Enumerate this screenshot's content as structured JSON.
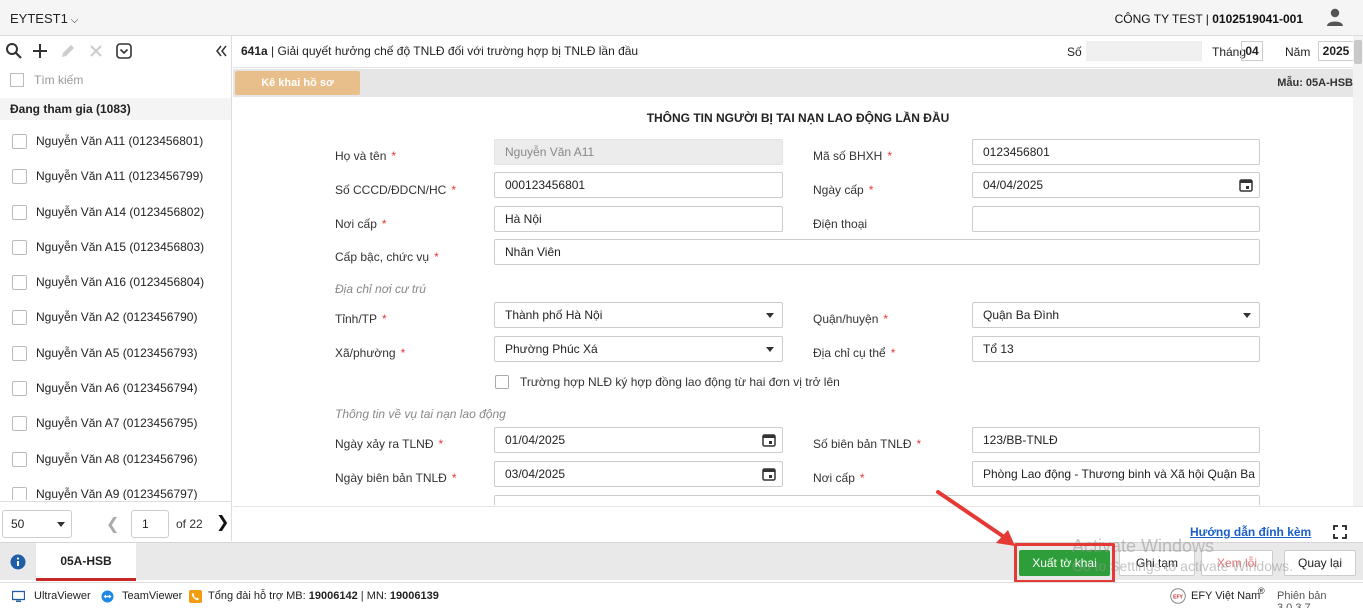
{
  "topbar": {
    "tenant": "EYTEST1",
    "company_name": "CÔNG TY TEST | ",
    "company_code": "0102519041-001"
  },
  "left_panel": {
    "search_placeholder": "Tìm kiếm",
    "group_label": "Đang tham gia (1083)",
    "items": [
      "Nguyễn Văn A11 (0123456801)",
      "Nguyễn Văn A11 (0123456799)",
      "Nguyễn Văn A14 (0123456802)",
      "Nguyễn Văn A15 (0123456803)",
      "Nguyễn Văn A16 (0123456804)",
      "Nguyễn Văn A2 (0123456790)",
      "Nguyễn Văn A5 (0123456793)",
      "Nguyễn Văn A6 (0123456794)",
      "Nguyễn Văn A7 (0123456795)",
      "Nguyễn Văn A8 (0123456796)",
      "Nguyễn Văn A9 (0123456797)"
    ],
    "pager": {
      "page_size": "50",
      "page": "1",
      "of_label": "of 22"
    }
  },
  "header": {
    "code": "641a",
    "title": " | Giải quyết hưởng chế độ TNLĐ đối với trường hợp bị TNLĐ lần đầu",
    "so_label": "Số",
    "thang_label": "Tháng",
    "thang_value": "04",
    "nam_label": "Năm",
    "nam_value": "2025"
  },
  "subbar": {
    "kekhai_label": "Kê khai hồ sơ",
    "mau_label": "Mẫu: 05A-HSB"
  },
  "form": {
    "title": "THÔNG TIN NGƯỜI BỊ TAI NẠN LAO ĐỘNG LẦN ĐẦU",
    "ho_ten_label": "Họ và tên",
    "ho_ten_value": "Nguyễn Văn A11",
    "ma_so_bhxh_label": "Mã số BHXH",
    "ma_so_bhxh_value": "0123456801",
    "cccd_label": "Số CCCD/ĐDCN/HC",
    "cccd_value": "000123456801",
    "ngay_cap_label": "Ngày cấp",
    "ngay_cap_value": "04/04/2025",
    "noi_cap_label": "Nơi cấp",
    "noi_cap_value": "Hà Nội",
    "dien_thoai_label": "Điện thoại",
    "dien_thoai_value": "",
    "cap_bac_label": "Cấp bậc, chức vụ",
    "cap_bac_value": "Nhân Viên",
    "section_address": "Địa chỉ nơi cư trú",
    "tinh_label": "Tỉnh/TP",
    "tinh_value": "Thành phố Hà Nội",
    "quan_label": "Quận/huyện",
    "quan_value": "Quận Ba Đình",
    "xa_label": "Xã/phường",
    "xa_value": "Phường Phúc Xá",
    "dia_chi_label": "Địa chỉ cụ thể",
    "dia_chi_value": "Tổ 13",
    "multi_contract_label": "Trường hợp NLĐ ký hợp đồng lao động từ hai đơn vị trở lên",
    "section_accident": "Thông tin về vụ tai nạn lao động",
    "ngay_xay_ra_label": "Ngày xảy ra TLNĐ",
    "ngay_xay_ra_value": "01/04/2025",
    "so_bien_ban_label": "Số biên bản TNLĐ",
    "so_bien_ban_value": "123/BB-TNLĐ",
    "ngay_bien_ban_label": "Ngày biên bản TNLĐ",
    "ngay_bien_ban_value": "03/04/2025",
    "noi_cap2_label": "Nơi cấp",
    "noi_cap2_value": "Phòng Lao động - Thương binh và Xã hội Quận Ba"
  },
  "guide": {
    "link_label": "Hướng dẫn đính kèm"
  },
  "footer": {
    "tab_label": "05A-HSB",
    "export_label": "Xuất tờ khai",
    "save_draft_label": "Ghi tạm",
    "view_error_label": "Xem lỗi",
    "back_label": "Quay lại",
    "watermark_line1": "Activate Windows",
    "watermark_line2": "Go to Settings to activate Windows."
  },
  "statusbar": {
    "ultraviewer": "UltraViewer",
    "teamviewer": "TeamViewer",
    "support_prefix": "Tổng đài hỗ trợ MB: ",
    "support_mb": "19006142",
    "support_mid": " | MN: ",
    "support_mn": "19006139",
    "brand": "EFY Việt Nam",
    "version": "Phiên bản 3.0.3.7"
  },
  "colors": {
    "accent_green": "#2e9e3a",
    "highlight_red": "#e53935",
    "kekhai_orange": "#e8bf8b",
    "link_blue": "#1a5fc9"
  }
}
